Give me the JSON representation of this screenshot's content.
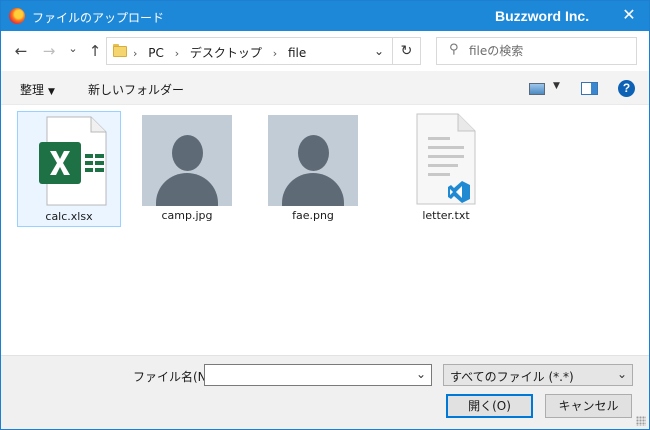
{
  "window": {
    "title": "ファイルのアップロード",
    "brand": "Buzzword Inc.",
    "close_glyph": "✕",
    "title_bar_color": "#1e88d8"
  },
  "nav": {
    "back_glyph": "←",
    "forward_glyph": "→",
    "recent_glyph": "⌄",
    "up_glyph": "↑",
    "breadcrumbs": [
      "PC",
      "デスクトップ",
      "file"
    ],
    "crumb_separator": "›",
    "dropdown_glyph": "⌄",
    "refresh_glyph": "↻",
    "search_icon_glyph": "⚲",
    "search_placeholder": "fileの検索"
  },
  "toolbar": {
    "organize_label": "整理",
    "organize_caret": "▼",
    "new_folder_label": "新しいフォルダー",
    "view_caret": "▼",
    "help_label": "?"
  },
  "files": [
    {
      "name": "calc.xlsx",
      "icon": "excel-file-icon",
      "selected": true
    },
    {
      "name": "camp.jpg",
      "icon": "person-image-icon",
      "selected": false
    },
    {
      "name": "fae.png",
      "icon": "person-image-icon",
      "selected": false
    },
    {
      "name": "letter.txt",
      "icon": "text-file-icon",
      "selected": false
    }
  ],
  "bottom": {
    "filename_label": "ファイル名(N):",
    "filename_value": "",
    "dropdown_glyph": "⌄",
    "filetype_value": "すべてのファイル (*.*)",
    "open_label": "開く(O)",
    "cancel_label": "キャンセル"
  },
  "colors": {
    "accent": "#0078d7",
    "selection_bg": "#eaf5ff",
    "selection_border": "#99d1ff",
    "excel_green": "#1e7145",
    "vscode_blue": "#1f8ad2"
  }
}
